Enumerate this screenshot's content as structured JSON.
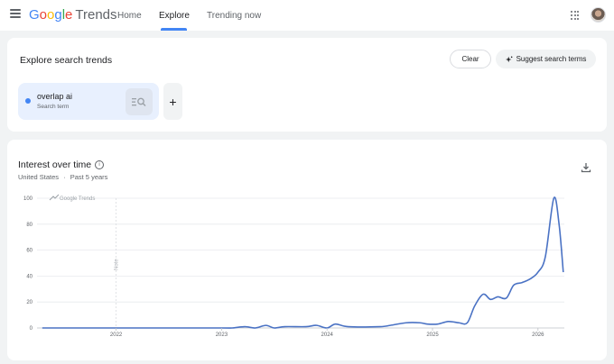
{
  "header": {
    "logo": {
      "google": "Google",
      "product": "Trends"
    },
    "nav": [
      {
        "label": "Home"
      },
      {
        "label": "Explore"
      },
      {
        "label": "Trending now"
      }
    ],
    "active_tab": "Explore"
  },
  "explore": {
    "title": "Explore search trends",
    "clear_label": "Clear",
    "suggest_label": "Suggest search terms",
    "term": {
      "name": "overlap ai",
      "type": "Search term",
      "color": "#4285f4"
    },
    "add_label": "+"
  },
  "interest": {
    "title": "Interest over time",
    "region": "United States",
    "separator": "·",
    "period": "Past 5 years",
    "watermark": "Google Trends",
    "note": "Note"
  },
  "colors": {
    "accent": "#4285f4",
    "line": "#4a72c4",
    "grid": "#e8eaed"
  },
  "chart_data": {
    "type": "line",
    "ylim": [
      0,
      100
    ],
    "yticks": [
      0,
      20,
      40,
      60,
      80,
      100
    ],
    "xlim": [
      2021.25,
      2026.25
    ],
    "xticks": [
      {
        "label": "2022",
        "x": 2022.0
      },
      {
        "label": "2023",
        "x": 2023.0
      },
      {
        "label": "2024",
        "x": 2024.0
      },
      {
        "label": "2025",
        "x": 2025.0
      },
      {
        "label": "2026",
        "x": 2026.0
      }
    ],
    "note_at": 2022.0,
    "series": [
      {
        "points": [
          [
            2021.3,
            0
          ],
          [
            2022.0,
            0
          ],
          [
            2022.5,
            0
          ],
          [
            2023.0,
            0
          ],
          [
            2023.1,
            0
          ],
          [
            2023.22,
            1
          ],
          [
            2023.32,
            0
          ],
          [
            2023.42,
            2
          ],
          [
            2023.5,
            0
          ],
          [
            2023.6,
            1
          ],
          [
            2023.8,
            1
          ],
          [
            2023.9,
            2
          ],
          [
            2024.0,
            0
          ],
          [
            2024.08,
            3
          ],
          [
            2024.2,
            1
          ],
          [
            2024.5,
            1
          ],
          [
            2024.6,
            2
          ],
          [
            2024.75,
            4
          ],
          [
            2024.88,
            4
          ],
          [
            2024.95,
            3
          ],
          [
            2025.05,
            3
          ],
          [
            2025.15,
            5
          ],
          [
            2025.25,
            4
          ],
          [
            2025.33,
            4
          ],
          [
            2025.4,
            17
          ],
          [
            2025.48,
            26
          ],
          [
            2025.55,
            22
          ],
          [
            2025.62,
            24
          ],
          [
            2025.7,
            23
          ],
          [
            2025.77,
            33
          ],
          [
            2025.85,
            35
          ],
          [
            2025.93,
            38
          ],
          [
            2026.0,
            43
          ],
          [
            2026.07,
            55
          ],
          [
            2026.15,
            100
          ],
          [
            2026.2,
            80
          ],
          [
            2026.24,
            43
          ]
        ]
      }
    ]
  }
}
